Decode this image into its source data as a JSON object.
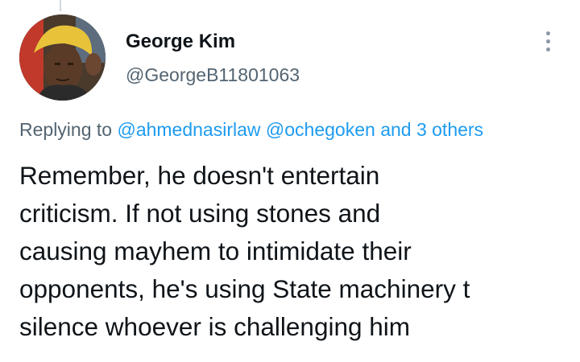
{
  "author": {
    "name": "George Kim",
    "handle": "@GeorgeB11801063"
  },
  "icons": {
    "more": "more-vertical-icon"
  },
  "reply": {
    "prefix": "Replying to",
    "mention1": "@ahmednasirlaw",
    "mention2": "@ochegoken",
    "others": "and 3 others"
  },
  "tweet": {
    "lines": [
      "Remember, he doesn't entertain",
      "criticism. If not using stones and",
      "causing mayhem to intimidate their",
      "opponents, he's using State machinery t",
      "silence whoever is challenging him"
    ]
  },
  "colors": {
    "link": "#1d9bf0",
    "secondary_text": "#536471",
    "primary_text": "#0f1419"
  }
}
